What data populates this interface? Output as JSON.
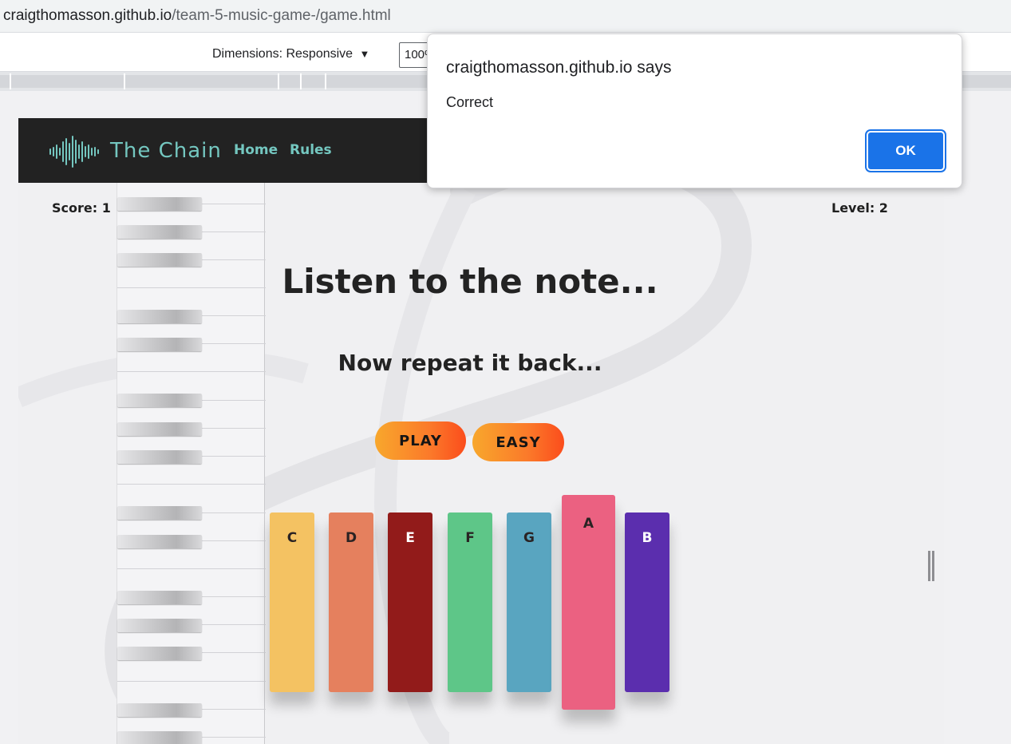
{
  "browser": {
    "url_domain": "craigthomasson.github.io",
    "url_path": "/team-5-music-game-/game.html"
  },
  "devtools": {
    "dimensions_label": "Dimensions: Responsive",
    "dropdown_glyph": "▼",
    "zoom_value": "100%"
  },
  "site": {
    "logo_text": "The Chain",
    "nav": [
      "Home",
      "Rules"
    ],
    "accent_color": "#74c7c0"
  },
  "game": {
    "score_label": "Score: 1",
    "level_label": "Level: 2",
    "headline": "Listen to the note...",
    "subline": "Now repeat it back...",
    "play_label": "PLAY",
    "difficulty_label": "EASY",
    "notes": [
      {
        "label": "C",
        "color": "#f4c262"
      },
      {
        "label": "D",
        "color": "#e5805e"
      },
      {
        "label": "E",
        "color": "#921b1a"
      },
      {
        "label": "F",
        "color": "#5ec688"
      },
      {
        "label": "G",
        "color": "#59a5c0"
      },
      {
        "label": "A",
        "color": "#eb6181",
        "active": true
      },
      {
        "label": "B",
        "color": "#5b2eae"
      }
    ]
  },
  "dialog": {
    "title": "craigthomasson.github.io says",
    "message": "Correct",
    "ok_label": "OK",
    "button_color": "#1a73e8"
  }
}
